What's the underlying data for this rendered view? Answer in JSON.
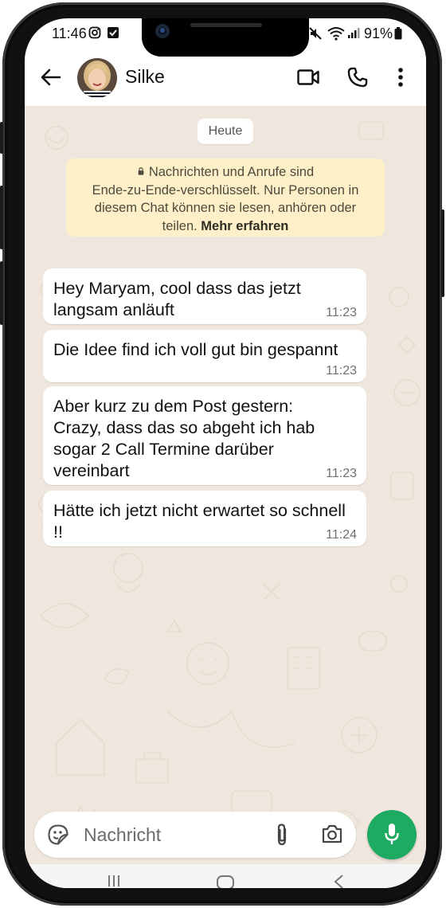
{
  "status_bar": {
    "time": "11:46",
    "battery": "91%"
  },
  "contact": {
    "name": "Silke"
  },
  "date_chip": "Heute",
  "encryption_notice": {
    "line1": "Nachrichten und Anrufe sind",
    "line2": "Ende-zu-Ende-verschlüsselt. Nur Personen in",
    "line3": "diesem Chat können sie lesen, anhören oder",
    "line4_prefix": "teilen.",
    "link": "Mehr erfahren"
  },
  "messages": [
    {
      "text": "Hey Maryam, cool dass das jetzt langsam anläuft",
      "time": "11:23"
    },
    {
      "text": "Die Idee find ich voll gut bin gespannt",
      "time": "11:23"
    },
    {
      "text": "Aber kurz zu dem Post gestern: Crazy, dass das so abgeht ich hab sogar 2 Call Termine darüber vereinbart",
      "time": "11:23"
    },
    {
      "text": "Hätte ich jetzt nicht erwartet so schnell !!",
      "time": "11:24"
    }
  ],
  "composer": {
    "placeholder": "Nachricht"
  },
  "colors": {
    "chat_background": "#efe7dd",
    "bubble_incoming": "#ffffff",
    "encryption_notice_bg": "#fdf0c9",
    "accent_green": "#1daa61"
  },
  "icons": [
    "back-arrow-icon",
    "video-call-icon",
    "phone-icon",
    "more-options-icon",
    "lock-icon",
    "emoji-sticker-icon",
    "attach-icon",
    "camera-icon",
    "mic-icon"
  ]
}
